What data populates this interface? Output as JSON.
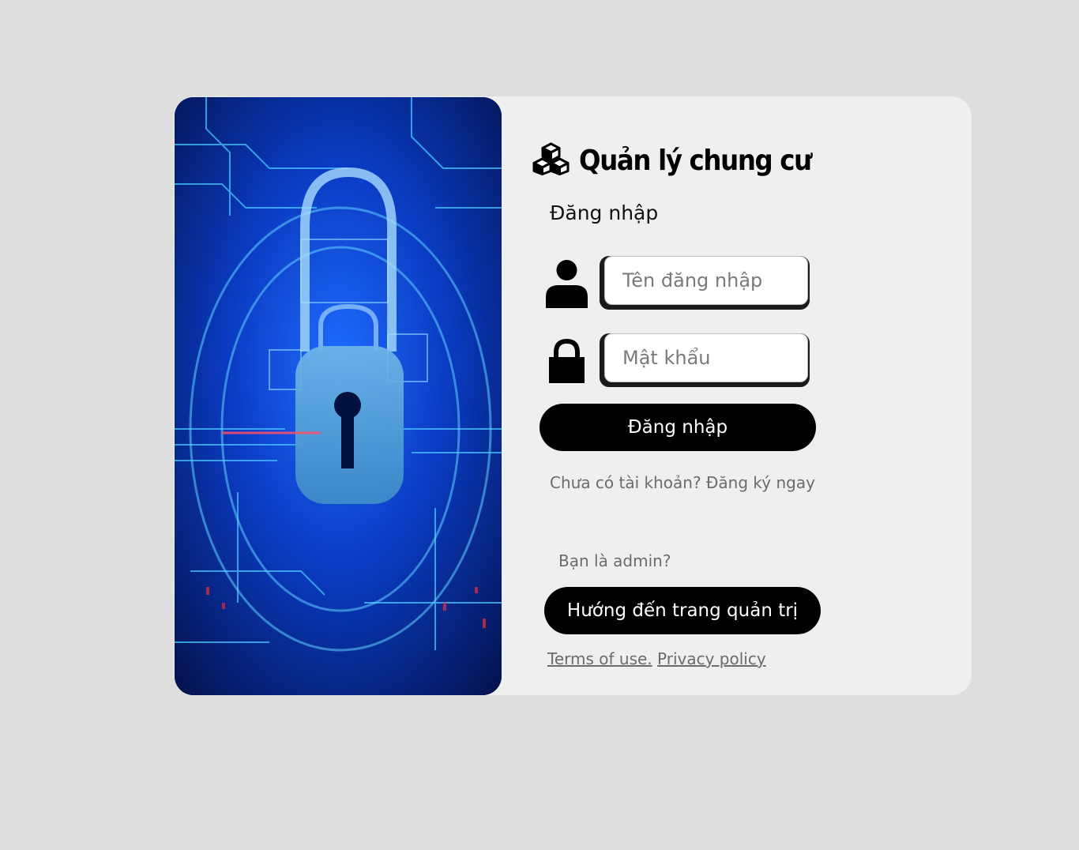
{
  "brand": {
    "title": "Quản lý chung cư",
    "logo_icon": "cubes-icon"
  },
  "login": {
    "heading": "Đăng nhập",
    "username": {
      "icon": "user-icon",
      "placeholder": "Tên đăng nhập",
      "value": ""
    },
    "password": {
      "icon": "lock-icon",
      "placeholder": "Mật khẩu",
      "value": ""
    },
    "submit_label": "Đăng nhập",
    "signup_text": "Chưa có tài khoản? Đăng ký ngay"
  },
  "admin": {
    "question": "Bạn là admin?",
    "button_label": "Hướng đến trang quản trị"
  },
  "footer": {
    "terms_label": "Terms of use.",
    "privacy_label": "Privacy policy"
  },
  "colors": {
    "page_background": "#dedede",
    "card_background": "#efefef",
    "button_background": "#000000",
    "muted_text": "#6b6b6b"
  }
}
